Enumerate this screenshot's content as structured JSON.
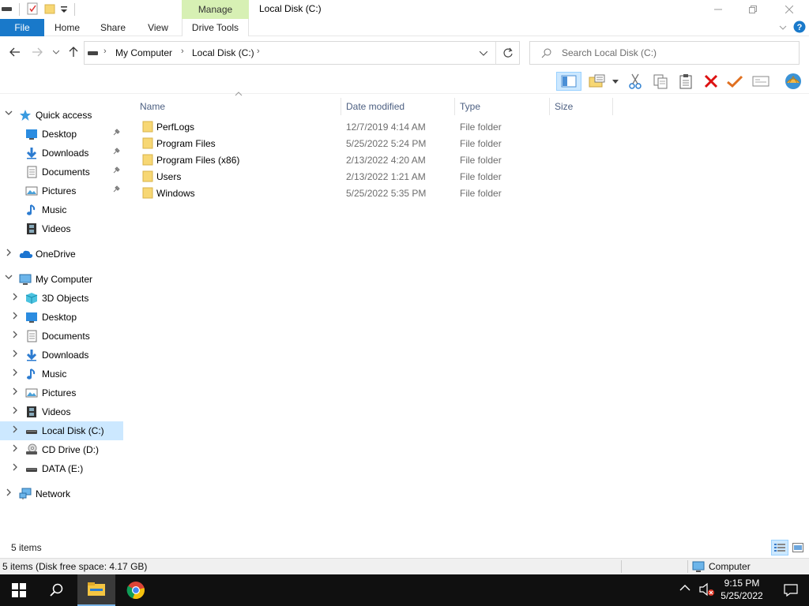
{
  "window": {
    "title": "Local Disk (C:)",
    "manage_label": "Manage"
  },
  "ribbon": {
    "tabs": [
      "File",
      "Home",
      "Share",
      "View",
      "Drive Tools"
    ]
  },
  "address": {
    "breadcrumbs": [
      "My Computer",
      "Local Disk (C:)"
    ],
    "search_placeholder": "Search Local Disk (C:)"
  },
  "nav": {
    "quick_access": "Quick access",
    "quick_items": [
      "Desktop",
      "Downloads",
      "Documents",
      "Pictures",
      "Music",
      "Videos"
    ],
    "onedrive": "OneDrive",
    "my_computer": "My Computer",
    "computer_items": [
      "3D Objects",
      "Desktop",
      "Documents",
      "Downloads",
      "Music",
      "Pictures",
      "Videos",
      "Local Disk (C:)",
      "CD Drive (D:)",
      "DATA (E:)"
    ],
    "network": "Network"
  },
  "columns": [
    "Name",
    "Date modified",
    "Type",
    "Size"
  ],
  "files": [
    {
      "name": "PerfLogs",
      "date": "12/7/2019 4:14 AM",
      "type": "File folder"
    },
    {
      "name": "Program Files",
      "date": "5/25/2022 5:24 PM",
      "type": "File folder"
    },
    {
      "name": "Program Files (x86)",
      "date": "2/13/2022 4:20 AM",
      "type": "File folder"
    },
    {
      "name": "Users",
      "date": "2/13/2022 1:21 AM",
      "type": "File folder"
    },
    {
      "name": "Windows",
      "date": "5/25/2022 5:35 PM",
      "type": "File folder"
    }
  ],
  "status": {
    "item_count": "5 items",
    "detail": "5 items (Disk free space: 4.17 GB)",
    "location": "Computer"
  },
  "taskbar": {
    "time": "9:15 PM",
    "date": "5/25/2022"
  },
  "colors": {
    "file_tab": "#1979ca",
    "manage_tab": "#d7f0b4",
    "selection": "#cce8ff",
    "folder": "#f7d774",
    "taskbar": "#101010"
  }
}
